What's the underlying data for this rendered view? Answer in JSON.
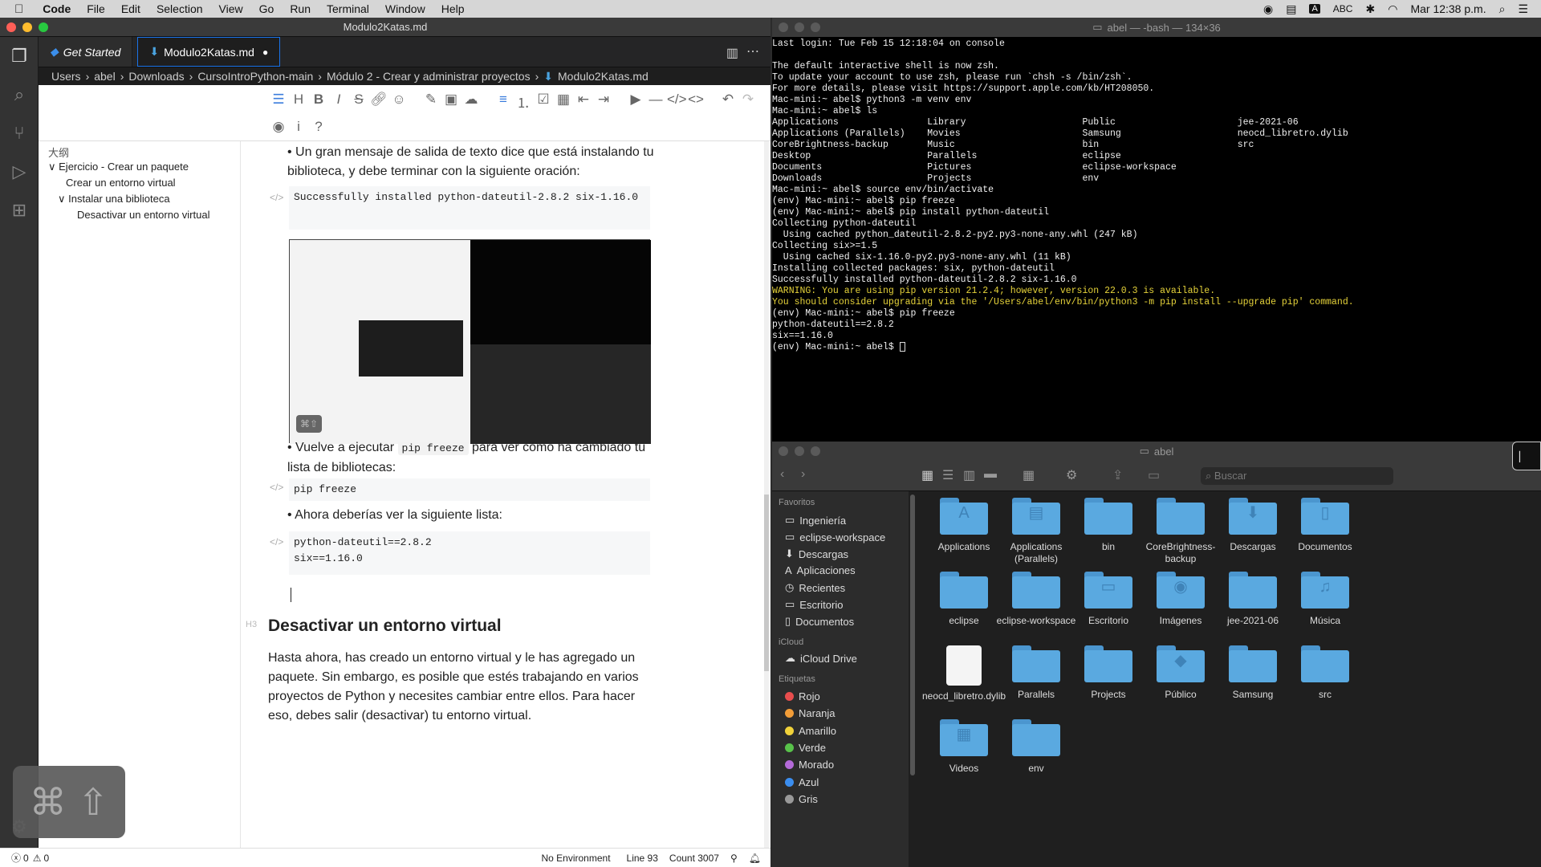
{
  "menubar": {
    "app": "Code",
    "items": [
      "File",
      "Edit",
      "Selection",
      "View",
      "Go",
      "Run",
      "Terminal",
      "Window",
      "Help"
    ],
    "input_source": "ABC",
    "clock": "Mar 12:38 p.m."
  },
  "vscode": {
    "window_title": "Modulo2Katas.md",
    "tabs": [
      "Get Started",
      "Modulo2Katas.md"
    ],
    "breadcrumb": [
      "Users",
      "abel",
      "Downloads",
      "CursoIntroPython-main",
      "Módulo 2 - Crear y administrar proyectos",
      "Modulo2Katas.md"
    ],
    "outline": {
      "header": "大纲",
      "items": [
        "Ejercicio - Crear un paquete",
        "Crear un entorno virtual",
        "Instalar una biblioteca",
        "Desactivar un entorno virtual"
      ]
    },
    "editor": {
      "p1": "Un gran mensaje de salida de texto dice que está instalando tu biblioteca, y debe terminar con la siguiente oración:",
      "code1": "Successfully installed python-dateutil-2.8.2 six-1.16.0",
      "p2_before": "Vuelve a ejecutar ",
      "p2_code": "pip freeze",
      "p2_after": " para ver cómo ha cambiado tu lista de bibliotecas:",
      "code2": "pip freeze",
      "p3": "Ahora deberías ver la siguiente lista:",
      "code3": "python-dateutil==2.8.2\nsix==1.16.0",
      "heading_tag": "H3",
      "heading": "Desactivar un entorno virtual",
      "p4": "Hasta ahora, has creado un entorno virtual y le has agregado un paquete. Sin embargo, es posible que estés trabajando en varios proyectos de Python y necesites cambiar entre ellos. Para hacer eso, debes salir (desactivar) tu entorno virtual."
    },
    "status": {
      "problems": "0",
      "warnings": "0",
      "env": "No Environment",
      "line": "Line 93",
      "count": "Count 3007"
    }
  },
  "terminal": {
    "title": "abel — -bash — 134×36",
    "lines": [
      "Last login: Tue Feb 15 12:18:04 on console",
      "",
      "The default interactive shell is now zsh.",
      "To update your account to use zsh, please run `chsh -s /bin/zsh`.",
      "For more details, please visit https://support.apple.com/kb/HT208050.",
      "Mac-mini:~ abel$ python3 -m venv env",
      "Mac-mini:~ abel$ ls",
      "Applications                Library                     Public                      jee-2021-06",
      "Applications (Parallels)    Movies                      Samsung                     neocd_libretro.dylib",
      "CoreBrightness-backup       Music                       bin                         src",
      "Desktop                     Parallels                   eclipse",
      "Documents                   Pictures                    eclipse-workspace",
      "Downloads                   Projects                    env",
      "Mac-mini:~ abel$ source env/bin/activate",
      "(env) Mac-mini:~ abel$ pip freeze",
      "(env) Mac-mini:~ abel$ pip install python-dateutil",
      "Collecting python-dateutil",
      "  Using cached python_dateutil-2.8.2-py2.py3-none-any.whl (247 kB)",
      "Collecting six>=1.5",
      "  Using cached six-1.16.0-py2.py3-none-any.whl (11 kB)",
      "Installing collected packages: six, python-dateutil",
      "Successfully installed python-dateutil-2.8.2 six-1.16.0",
      "WARNING: You are using pip version 21.2.4; however, version 22.0.3 is available.",
      "You should consider upgrading via the '/Users/abel/env/bin/python3 -m pip install --upgrade pip' command.",
      "(env) Mac-mini:~ abel$ pip freeze",
      "python-dateutil==2.8.2",
      "six==1.16.0",
      "(env) Mac-mini:~ abel$ "
    ],
    "warning_line_indexes": [
      22,
      23
    ]
  },
  "finder": {
    "title": "abel",
    "search_placeholder": "Buscar",
    "sidebar": {
      "favorites_header": "Favoritos",
      "favorites": [
        "Ingeniería",
        "eclipse-workspace",
        "Descargas",
        "Aplicaciones",
        "Recientes",
        "Escritorio",
        "Documentos"
      ],
      "icloud_header": "iCloud",
      "icloud": [
        "iCloud Drive"
      ],
      "tags_header": "Etiquetas",
      "tags": [
        {
          "name": "Rojo",
          "color": "#e84d4d"
        },
        {
          "name": "Naranja",
          "color": "#f29d38"
        },
        {
          "name": "Amarillo",
          "color": "#f1d23a"
        },
        {
          "name": "Verde",
          "color": "#58c24a"
        },
        {
          "name": "Morado",
          "color": "#b46ad9"
        },
        {
          "name": "Azul",
          "color": "#3b8ef0"
        },
        {
          "name": "Gris",
          "color": "#999999"
        }
      ]
    },
    "items": [
      {
        "name": "Applications",
        "glyph": "A"
      },
      {
        "name": "Applications (Parallels)",
        "glyph": "▤"
      },
      {
        "name": "bin",
        "glyph": ""
      },
      {
        "name": "CoreBrightness-backup",
        "glyph": ""
      },
      {
        "name": "Descargas",
        "glyph": "⬇"
      },
      {
        "name": "Documentos",
        "glyph": "▯"
      },
      {
        "name": "eclipse",
        "glyph": ""
      },
      {
        "name": "eclipse-workspace",
        "glyph": ""
      },
      {
        "name": "Escritorio",
        "glyph": "▭"
      },
      {
        "name": "Imágenes",
        "glyph": "◉"
      },
      {
        "name": "jee-2021-06",
        "glyph": ""
      },
      {
        "name": "Música",
        "glyph": "♫"
      },
      {
        "name": "neocd_libretro.dylib",
        "glyph": "file"
      },
      {
        "name": "Parallels",
        "glyph": ""
      },
      {
        "name": "Projects",
        "glyph": ""
      },
      {
        "name": "Público",
        "glyph": "◆"
      },
      {
        "name": "Samsung",
        "glyph": ""
      },
      {
        "name": "src",
        "glyph": ""
      },
      {
        "name": "Videos",
        "glyph": "▦"
      },
      {
        "name": "env",
        "glyph": ""
      }
    ]
  }
}
